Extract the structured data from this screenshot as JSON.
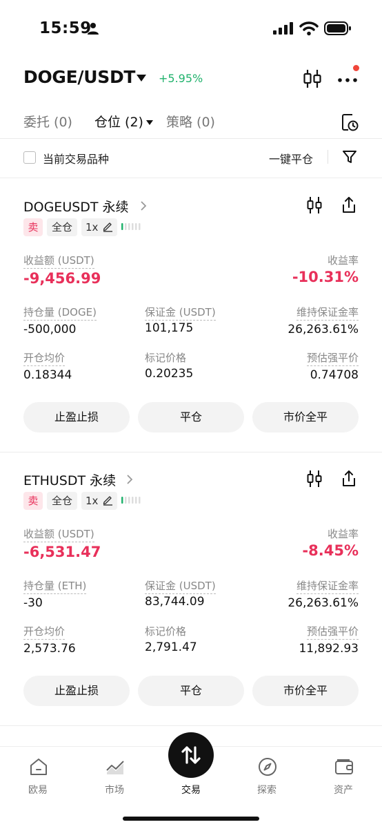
{
  "status_bar": {
    "time": "15:59"
  },
  "header": {
    "pair": "DOGE/USDT",
    "change": "+5.95%",
    "change_color": "#20b26c"
  },
  "tabs": [
    {
      "label": "委托 (0)"
    },
    {
      "label": "仓位 (2)"
    },
    {
      "label": "策略 (0)"
    }
  ],
  "filter": {
    "checkbox_label": "当前交易品种",
    "close_all_label": "一键平仓"
  },
  "labels": {
    "pnl": "收益额 (USDT)",
    "rate": "收益率",
    "margin": "保证金 (USDT)",
    "maint_ratio": "维持保证金率",
    "avg_open": "开仓均价",
    "mark_price": "标记价格",
    "liq_price": "预估强平价"
  },
  "buttons": {
    "tpsl": "止盈止损",
    "close": "平仓",
    "market_close": "市价全平"
  },
  "positions": [
    {
      "symbol": "DOGEUSDT 永续",
      "side": "卖",
      "margin_mode": "全仓",
      "leverage": "1x",
      "pnl": "-9,456.99",
      "rate": "-10.31%",
      "size_label": "持仓量 (DOGE)",
      "size": "-500,000",
      "margin": "101,175",
      "maint_ratio": "26,263.61%",
      "avg_open": "0.18344",
      "mark_price": "0.20235",
      "liq_price": "0.74708"
    },
    {
      "symbol": "ETHUSDT 永续",
      "side": "卖",
      "margin_mode": "全仓",
      "leverage": "1x",
      "pnl": "-6,531.47",
      "rate": "-8.45%",
      "size_label": "持仓量 (ETH)",
      "size": "-30",
      "margin": "83,744.09",
      "maint_ratio": "26,263.61%",
      "avg_open": "2,573.76",
      "mark_price": "2,791.47",
      "liq_price": "11,892.93"
    }
  ],
  "colors": {
    "loss": "#e8305a",
    "gain": "#20b26c",
    "accent_dark": "#111111"
  },
  "bottom_nav": [
    {
      "label": "欧易",
      "icon": "home-icon"
    },
    {
      "label": "市场",
      "icon": "chart-icon"
    },
    {
      "label": "交易",
      "icon": "swap-icon"
    },
    {
      "label": "探索",
      "icon": "compass-icon"
    },
    {
      "label": "资产",
      "icon": "wallet-icon"
    }
  ]
}
